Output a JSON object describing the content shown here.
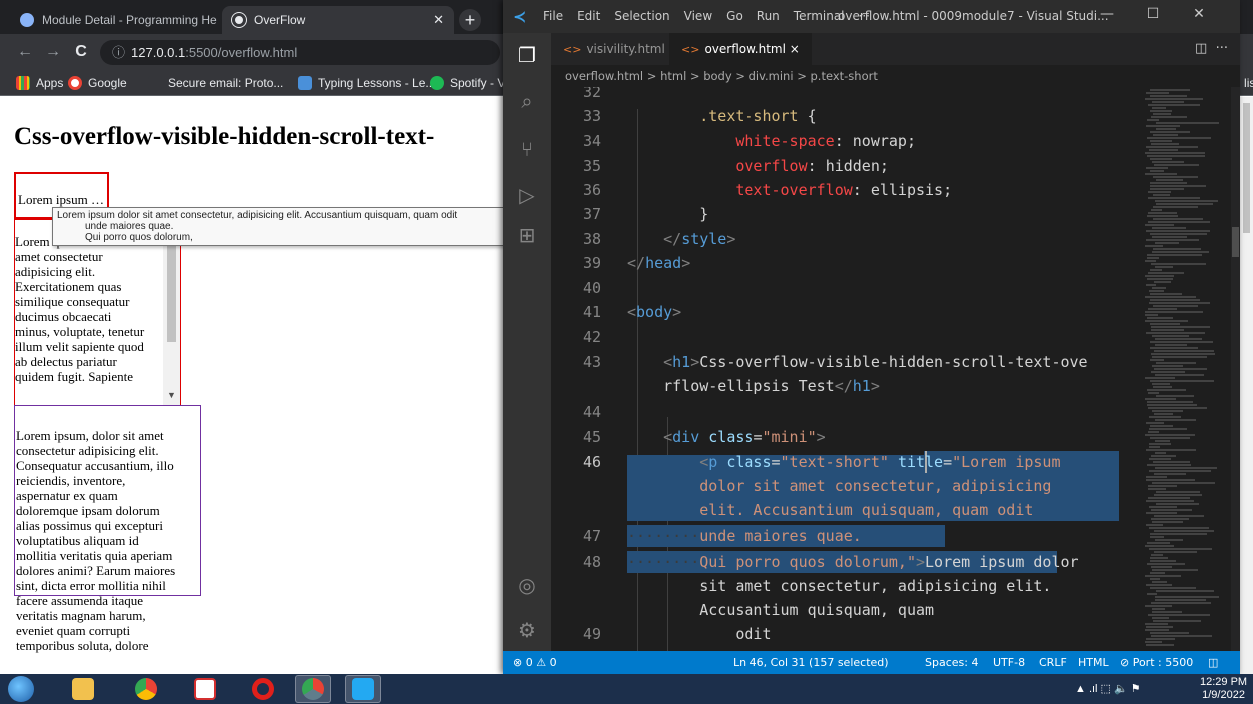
{
  "chrome": {
    "tabs": [
      {
        "title": "Module Detail - Programming He"
      },
      {
        "title": "OverFlow"
      }
    ],
    "new_tab": "+",
    "nav": {
      "back": "←",
      "forward": "→",
      "reload": "C"
    },
    "url": {
      "host": "127.0.0.1",
      "path": ":5500/overflow.html"
    },
    "bookmarks": [
      "Apps",
      "Google",
      "Secure email: Proto...",
      "Typing Lessons - Le...",
      "Spotify - V"
    ],
    "reading_list": "ding list"
  },
  "page": {
    "heading": "Css-overflow-visible-hidden-scroll-text-",
    "box1_text": "Lorem ipsum dolor sit amet consectetur, adipisicing elit.",
    "box2_lines": [
      "Lorem ipsum dolor sit",
      "amet consectetur",
      "adipisicing elit.",
      "Exercitationem quas",
      "similique consequatur",
      "ducimus obcaecati",
      "minus, voluptate, tenetur",
      "illum velit sapiente quod",
      "ab delectus pariatur",
      "quidem fugit. Sapiente"
    ],
    "box3_lines": [
      "Lorem ipsum, dolor sit amet",
      "consectetur adipisicing elit.",
      "Consequatur accusantium, illo",
      "reiciendis, inventore,",
      "aspernatur ex quam",
      "doloremque ipsam dolorum",
      "alias possimus qui excepturi",
      "voluptatibus aliquam id",
      "mollitia veritatis quia aperiam",
      "dolores animi? Earum maiores",
      "sint, dicta error mollitia nihil",
      "facere assumenda itaque",
      "veritatis magnam harum,",
      "eveniet quam corrupti",
      "temporibus soluta, dolore"
    ],
    "tooltip": {
      "line1": "Lorem ipsum dolor sit amet consectetur, adipisicing elit. Accusantium quisquam, quam odit",
      "line2": "unde maiores quae.",
      "line3": "Qui porro quos dolorum,"
    }
  },
  "vscode": {
    "menu": [
      "File",
      "Edit",
      "Selection",
      "View",
      "Go",
      "Run",
      "Terminal",
      "···"
    ],
    "window_title": "overflow.html - 0009module7 - Visual Studi...",
    "window_buttons": {
      "minimize": "—",
      "maximize": "☐",
      "close": "✕"
    },
    "tabs": [
      {
        "label": "visivility.html",
        "active": false
      },
      {
        "label": "overflow.html",
        "active": true,
        "close": "×"
      }
    ],
    "breadcrumbs": "overflow.html > html > body > div.mini > p.text-short",
    "gutter": [
      "32",
      "33",
      "34",
      "35",
      "36",
      "37",
      "38",
      "39",
      "40",
      "41",
      "42",
      "43",
      "",
      "44",
      "45",
      "46",
      "",
      "",
      "47",
      "48",
      "",
      "",
      "49"
    ],
    "status": {
      "problems": "⊗ 0 ⚠ 0",
      "position": "Ln 46, Col 31 (157 selected)",
      "spaces": "Spaces: 4",
      "encoding": "UTF-8",
      "eol": "CRLF",
      "language": "HTML",
      "port": "⊘ Port : 5500"
    }
  },
  "taskbar": {
    "tray": "▲  .ıl  ⬚  🔈  ⚑",
    "time": "12:29 PM",
    "date": "1/9/2022"
  },
  "colors": {
    "vscode_status": "#007acc",
    "selection": "#264f78",
    "box_red": "#dd0000",
    "box_purple": "#7030a0"
  }
}
